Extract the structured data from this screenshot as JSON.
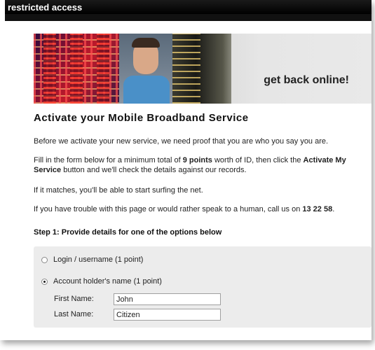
{
  "header": {
    "title": "restricted access"
  },
  "banner": {
    "tagline": "get back online!"
  },
  "page": {
    "heading": "Activate your Mobile Broadband Service",
    "para1": "Before we activate your new service, we need proof that you are who you say you are.",
    "para2": {
      "t1": "Fill in the form below for a minimum total of ",
      "b1": "9 points",
      "t2": " worth of ID, then click the ",
      "b2": "Activate My Service",
      "t3": " button and we'll check the details against our records."
    },
    "para3": "If it matches, you'll be able to start surfing the net.",
    "para4": {
      "t1": "If you have trouble with this page or would rather speak to a human, call us on ",
      "b1": "13 22 58",
      "t2": "."
    },
    "step1": "Step 1: Provide details for one of the options below"
  },
  "options": [
    {
      "label": "Login / username (1 point)",
      "selected": false
    },
    {
      "label": "Account holder's name (1 point)",
      "selected": true
    }
  ],
  "form": {
    "first_name_label": "First Name:",
    "first_name_value": "John",
    "last_name_label": "Last Name:",
    "last_name_value": "Citizen"
  }
}
